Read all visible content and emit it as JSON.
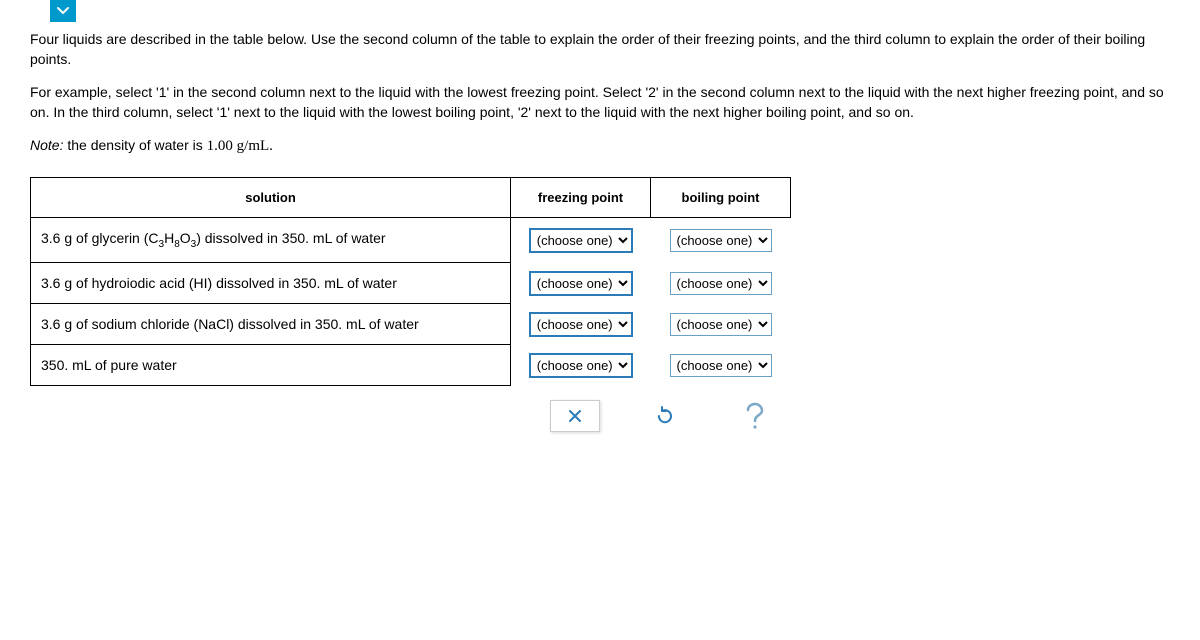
{
  "instructions": {
    "p1": "Four liquids are described in the table below. Use the second column of the table to explain the order of their freezing points, and the third column to explain the order of their boiling points.",
    "p2": "For example, select '1' in the second column next to the liquid with the lowest freezing point. Select '2' in the second column next to the liquid with the next higher freezing point, and so on. In the third column, select '1' next to the liquid with the lowest boiling point, '2' next to the liquid with the next higher boiling point, and so on.",
    "note_label": "Note:",
    "note_text": " the density of water is ",
    "density": "1.00 g/mL."
  },
  "headers": {
    "solution": "solution",
    "freezing": "freezing point",
    "boiling": "boiling point"
  },
  "rows": [
    {
      "pre": "3.6 g of glycerin (C",
      "sub1": "3",
      "mid1": "H",
      "sub2": "8",
      "mid2": "O",
      "sub3": "3",
      "post": ") dissolved in 350. mL of water"
    },
    {
      "pre": "3.6 g of hydroiodic acid (HI) dissolved in 350. mL of water",
      "sub1": "",
      "mid1": "",
      "sub2": "",
      "mid2": "",
      "sub3": "",
      "post": ""
    },
    {
      "pre": "3.6 g of sodium chloride (NaCl) dissolved in 350. mL of water",
      "sub1": "",
      "mid1": "",
      "sub2": "",
      "mid2": "",
      "sub3": "",
      "post": ""
    },
    {
      "pre": "350. mL of pure water",
      "sub1": "",
      "mid1": "",
      "sub2": "",
      "mid2": "",
      "sub3": "",
      "post": ""
    }
  ],
  "select": {
    "placeholder": "(choose one)"
  }
}
